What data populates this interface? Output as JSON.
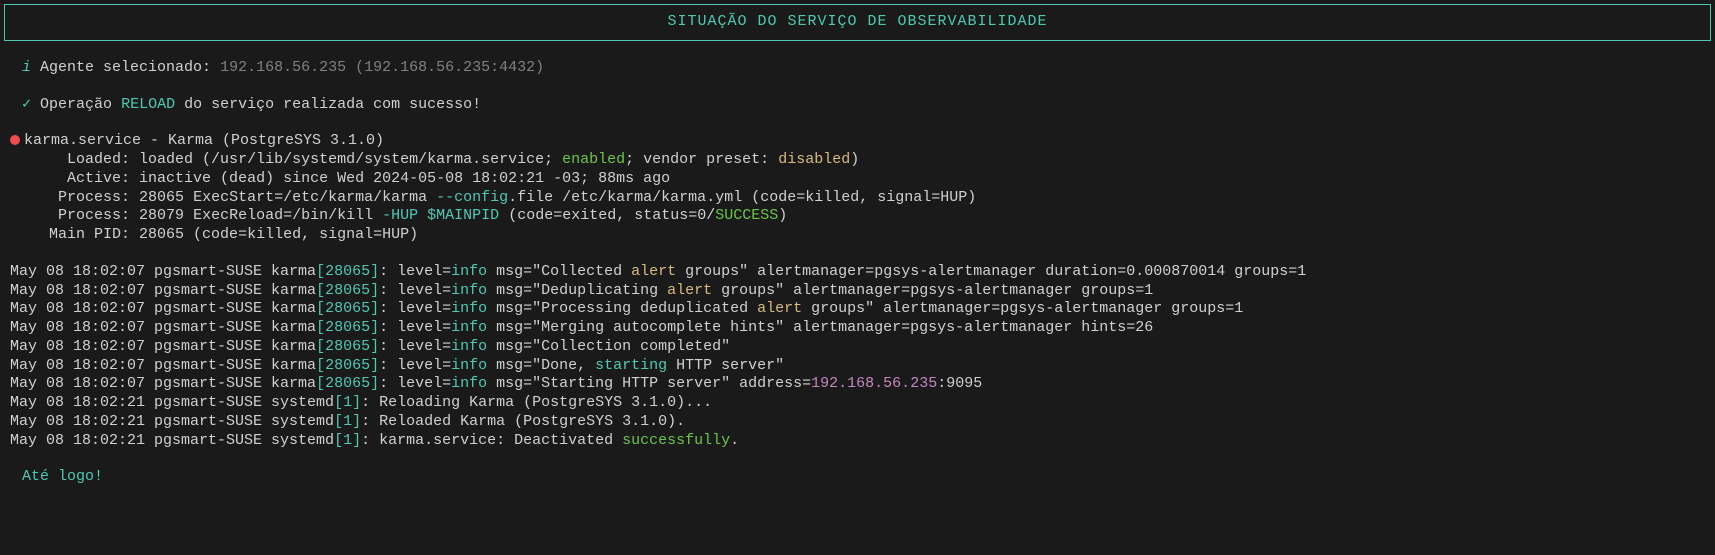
{
  "header": {
    "title": "SITUAÇÃO DO SERVIÇO DE OBSERVABILIDADE"
  },
  "agent": {
    "label": "Agente selecionado:",
    "value": "192.168.56.235 (192.168.56.235:4432)"
  },
  "operation": {
    "prefix": "Operação",
    "action": "RELOAD",
    "suffix": "do serviço realizada com sucesso!"
  },
  "service": {
    "line1": "karma.service - Karma (PostgreSYS 3.1.0)",
    "loaded_label": "Loaded:",
    "loaded_p1": "loaded (/usr/lib/systemd/system/karma.service;",
    "loaded_enabled": "enabled",
    "loaded_p2": "; vendor preset:",
    "loaded_disabled": "disabled",
    "loaded_p3": ")",
    "active_label": "Active:",
    "active_state": "inactive (dead)",
    "active_since": "since Wed 2024-05-08 18:02:21 -03; 88ms ago",
    "proc1_label": "Process:",
    "proc1_pid": "28065",
    "proc1_p1": "ExecStart=/etc/karma/karma",
    "proc1_flag": "--config",
    "proc1_p2": ".file /etc/karma/karma.yml",
    "proc1_result": "(code=killed, signal=HUP)",
    "proc2_label": "Process:",
    "proc2_pid": "28079",
    "proc2_p1": "ExecReload=/bin/kill",
    "proc2_flag": "-HUP",
    "proc2_var": "$MAINPID",
    "proc2_p2": "(code=exited, status=0/",
    "proc2_success": "SUCCESS",
    "proc2_p3": ")",
    "mainpid_label": "Main PID:",
    "mainpid_value": "28065 (code=killed, signal=HUP)"
  },
  "logs": [
    {
      "ts": "May 08 18:02:07",
      "host": "pgsmart-SUSE",
      "proc": "karma",
      "pid": "28065",
      "msg_pre": ": level=",
      "level": "info",
      "msg_mid": " msg=\"Collected ",
      "kw1": "alert",
      "msg_post": " groups\" alertmanager=pgsys-alertmanager duration=0.000870014 groups=1"
    },
    {
      "ts": "May 08 18:02:07",
      "host": "pgsmart-SUSE",
      "proc": "karma",
      "pid": "28065",
      "msg_pre": ": level=",
      "level": "info",
      "msg_mid": " msg=\"Deduplicating ",
      "kw1": "alert",
      "msg_post": " groups\" alertmanager=pgsys-alertmanager groups=1"
    },
    {
      "ts": "May 08 18:02:07",
      "host": "pgsmart-SUSE",
      "proc": "karma",
      "pid": "28065",
      "msg_pre": ": level=",
      "level": "info",
      "msg_mid": " msg=\"Processing deduplicated ",
      "kw1": "alert",
      "msg_post": " groups\" alertmanager=pgsys-alertmanager groups=1"
    },
    {
      "ts": "May 08 18:02:07",
      "host": "pgsmart-SUSE",
      "proc": "karma",
      "pid": "28065",
      "msg_pre": ": level=",
      "level": "info",
      "msg_mid": " msg=\"Merging autocomplete hints\" alertmanager=pgsys-alertmanager hints=26",
      "kw1": "",
      "msg_post": ""
    },
    {
      "ts": "May 08 18:02:07",
      "host": "pgsmart-SUSE",
      "proc": "karma",
      "pid": "28065",
      "msg_pre": ": level=",
      "level": "info",
      "msg_mid": " msg=\"Collection completed\"",
      "kw1": "",
      "msg_post": ""
    },
    {
      "ts": "May 08 18:02:07",
      "host": "pgsmart-SUSE",
      "proc": "karma",
      "pid": "28065",
      "msg_pre": ": level=",
      "level": "info",
      "msg_mid": " msg=\"Done, ",
      "kw1": "starting",
      "msg_post": " HTTP server\""
    },
    {
      "ts": "May 08 18:02:07",
      "host": "pgsmart-SUSE",
      "proc": "karma",
      "pid": "28065",
      "msg_pre": ": level=",
      "level": "info",
      "msg_mid": " msg=\"Starting HTTP server\" address=",
      "addr": "192.168.56.235",
      "msg_post": ":9095"
    },
    {
      "ts": "May 08 18:02:21",
      "host": "pgsmart-SUSE",
      "proc": "systemd",
      "pid": "1",
      "msg_pre": ": Reloading Karma (PostgreSYS 3.1.0)...",
      "level": "",
      "msg_mid": "",
      "kw1": "",
      "msg_post": ""
    },
    {
      "ts": "May 08 18:02:21",
      "host": "pgsmart-SUSE",
      "proc": "systemd",
      "pid": "1",
      "msg_pre": ": Reloaded Karma (PostgreSYS 3.1.0).",
      "level": "",
      "msg_mid": "",
      "kw1": "",
      "msg_post": ""
    },
    {
      "ts": "May 08 18:02:21",
      "host": "pgsmart-SUSE",
      "proc": "systemd",
      "pid": "1",
      "msg_pre": ": karma.service: Deactivated ",
      "level": "",
      "msg_mid": "",
      "kw1": "successfully",
      "msg_post": "."
    }
  ],
  "bye": "Até logo!"
}
